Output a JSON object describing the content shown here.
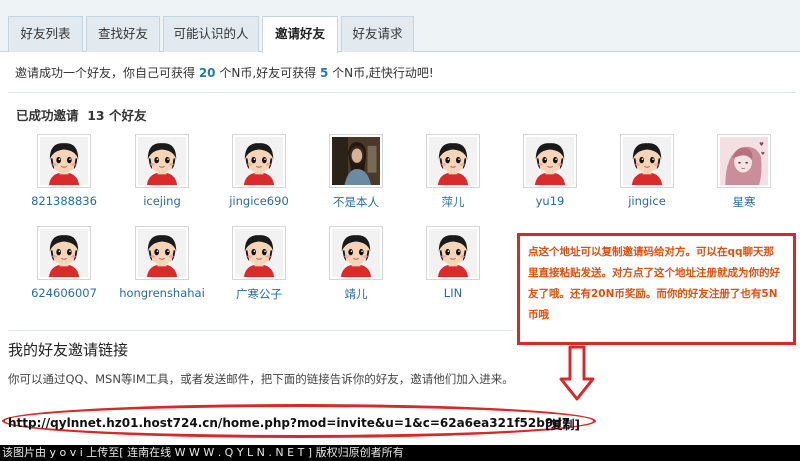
{
  "tabs": [
    "好友列表",
    "查找好友",
    "可能认识的人",
    "邀请好友",
    "好友请求"
  ],
  "info": {
    "prefix": "邀请成功一个好友，你自己可获得 ",
    "self_amount": "20",
    "middle": " 个N币,好友可获得 ",
    "friend_amount": "5",
    "suffix": " 个N币,赶快行动吧!"
  },
  "success": {
    "label": "已成功邀请",
    "count_text": "13 个好友"
  },
  "friends_row1": [
    {
      "name": "821388836",
      "avatar": "cartoon"
    },
    {
      "name": "icejing",
      "avatar": "cartoon"
    },
    {
      "name": "jingice690",
      "avatar": "cartoon"
    },
    {
      "name": "不是本人",
      "avatar": "photo-dark"
    },
    {
      "name": "萍儿",
      "avatar": "cartoon"
    },
    {
      "name": "yu19",
      "avatar": "cartoon"
    },
    {
      "name": "jingice",
      "avatar": "cartoon"
    },
    {
      "name": "星寒",
      "avatar": "photo-pink"
    }
  ],
  "friends_row2": [
    {
      "name": "624606007",
      "avatar": "cartoon"
    },
    {
      "name": "hongrenshahai",
      "avatar": "cartoon"
    },
    {
      "name": "广寒公子",
      "avatar": "cartoon"
    },
    {
      "name": "靖儿",
      "avatar": "cartoon"
    },
    {
      "name": "LIN",
      "avatar": "cartoon"
    }
  ],
  "callout": "点这个地址可以复制邀请码给对方。可以在qq聊天那里直接粘贴发送。对方点了这个地址注册就成为你的好友了哦。还有20N币奖励。而你的好友注册了也有5N币哦",
  "invite": {
    "title": "我的好友邀请链接",
    "desc": "你可以通过QQ、MSN等IM工具，或者发送邮件，把下面的链接告诉你的好友，邀请他们加入进来。",
    "url": "http://qylnnet.hz01.host724.cn/home.php?mod=invite&u=1&c=62a6ea321f52b9d7",
    "copy_label": "[复制]"
  },
  "footer": "该图片由  y o v i  上传至[ 连南在线 W W W . Q Y L N . N E T ]  版权归原创者所有",
  "colors": {
    "accent_blue": "#2a79a8",
    "name_blue": "#2a6aa0",
    "annotation_red": "#d42a2a",
    "annotation_text": "#e05010"
  }
}
